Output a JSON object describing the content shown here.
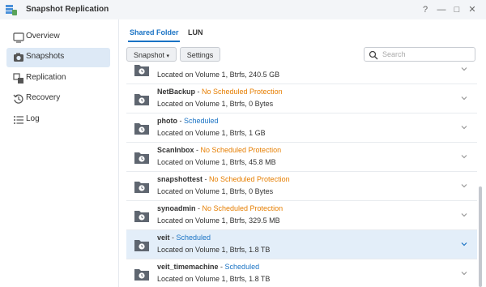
{
  "window": {
    "title": "Snapshot Replication",
    "help": "?",
    "minimize": "—",
    "maximize": "□",
    "close": "✕"
  },
  "sidebar": {
    "items": [
      {
        "label": "Overview",
        "icon": "overview-icon"
      },
      {
        "label": "Snapshots",
        "icon": "camera-icon"
      },
      {
        "label": "Replication",
        "icon": "replication-icon"
      },
      {
        "label": "Recovery",
        "icon": "recovery-icon"
      },
      {
        "label": "Log",
        "icon": "log-icon"
      }
    ],
    "active": "Snapshots"
  },
  "tabs": [
    {
      "label": "Shared Folder"
    },
    {
      "label": "LUN"
    }
  ],
  "toolbar": {
    "snapshot_label": "Snapshot",
    "settings_label": "Settings"
  },
  "search": {
    "placeholder": "Search",
    "value": ""
  },
  "colors": {
    "accent": "#1a73c4",
    "warning": "#e67e00",
    "selected_row": "#e3eef9"
  },
  "rows": [
    {
      "name": "",
      "sep": "",
      "status": "",
      "status_type": "",
      "location": "Located on Volume 1, Btrfs, 240.5 GB"
    },
    {
      "name": "NetBackup",
      "sep": " - ",
      "status": "No Scheduled Protection",
      "status_type": "none",
      "location": "Located on Volume 1, Btrfs, 0 Bytes"
    },
    {
      "name": "photo",
      "sep": " - ",
      "status": "Scheduled",
      "status_type": "scheduled",
      "location": "Located on Volume 1, Btrfs, 1 GB"
    },
    {
      "name": "ScanInbox",
      "sep": " - ",
      "status": "No Scheduled Protection",
      "status_type": "none",
      "location": "Located on Volume 1, Btrfs, 45.8 MB"
    },
    {
      "name": "snapshottest",
      "sep": " - ",
      "status": "No Scheduled Protection",
      "status_type": "none",
      "location": "Located on Volume 1, Btrfs, 0 Bytes"
    },
    {
      "name": "synoadmin",
      "sep": " - ",
      "status": "No Scheduled Protection",
      "status_type": "none",
      "location": "Located on Volume 1, Btrfs, 329.5 MB"
    },
    {
      "name": "veit",
      "sep": " - ",
      "status": "Scheduled",
      "status_type": "scheduled",
      "location": "Located on Volume 1, Btrfs, 1.8 TB",
      "selected": true
    },
    {
      "name": "veit_timemachine",
      "sep": " - ",
      "status": "Scheduled",
      "status_type": "scheduled",
      "location": "Located on Volume 1, Btrfs, 1.8 TB"
    }
  ]
}
